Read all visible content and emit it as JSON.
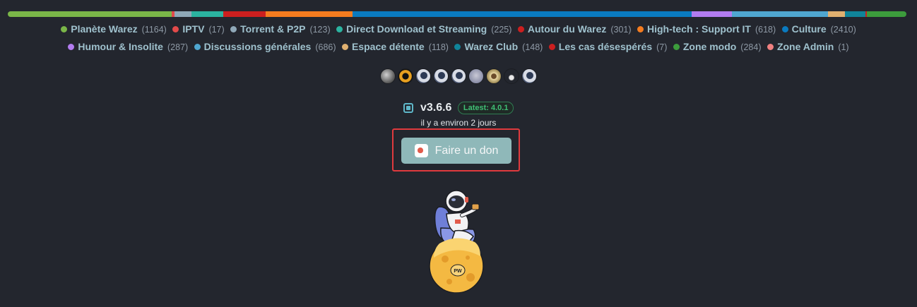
{
  "colors": {
    "background": "#23262e",
    "accent_button": "#8fb8b9",
    "highlight_border": "#e03a3e",
    "latest_badge": "#3fbf74"
  },
  "categories_row1": [
    {
      "name": "Planète Warez",
      "count": "(1164)",
      "color": "#7ab648"
    },
    {
      "name": "IPTV",
      "count": "(17)",
      "color": "#e24a4a"
    },
    {
      "name": "Torrent & P2P",
      "count": "(123)",
      "color": "#8fa8b8"
    },
    {
      "name": "Direct Download et Streaming",
      "count": "(225)",
      "color": "#2bb3a0"
    },
    {
      "name": "Autour du Warez",
      "count": "(301)",
      "color": "#cc1f1f"
    },
    {
      "name": "High-tech : Support IT",
      "count": "(618)",
      "color": "#f57c1f"
    },
    {
      "name": "Culture",
      "count": "(2410)",
      "color": "#0a7abf"
    }
  ],
  "categories_row2": [
    {
      "name": "Humour & Insolite",
      "count": "(287)",
      "color": "#b27cf0"
    },
    {
      "name": "Discussions générales",
      "count": "(686)",
      "color": "#4fa6d0"
    },
    {
      "name": "Espace détente",
      "count": "(118)",
      "color": "#e0b070"
    },
    {
      "name": "Warez Club",
      "count": "(148)",
      "color": "#10849a"
    },
    {
      "name": "Les cas désespérés",
      "count": "(7)",
      "color": "#cc1f1f"
    },
    {
      "name": "Zone modo",
      "count": "(284)",
      "color": "#3c9c3c"
    },
    {
      "name": "Zone Admin",
      "count": "(1)",
      "color": "#f08080"
    }
  ],
  "online_avatars": [
    "user-avatar",
    "user-avatar",
    "user-avatar",
    "user-avatar",
    "user-avatar",
    "user-avatar",
    "user-avatar",
    "user-avatar",
    "user-avatar"
  ],
  "version": {
    "current": "v3.6.6",
    "latest_label": "Latest: 4.0.1",
    "updated_ago": "il y a environ 2 jours"
  },
  "donate": {
    "label": "Faire un don",
    "icon": "coffee-cup-icon"
  },
  "mascot": {
    "badge_text": "PW",
    "icon": "astronaut-on-moon-illustration"
  }
}
